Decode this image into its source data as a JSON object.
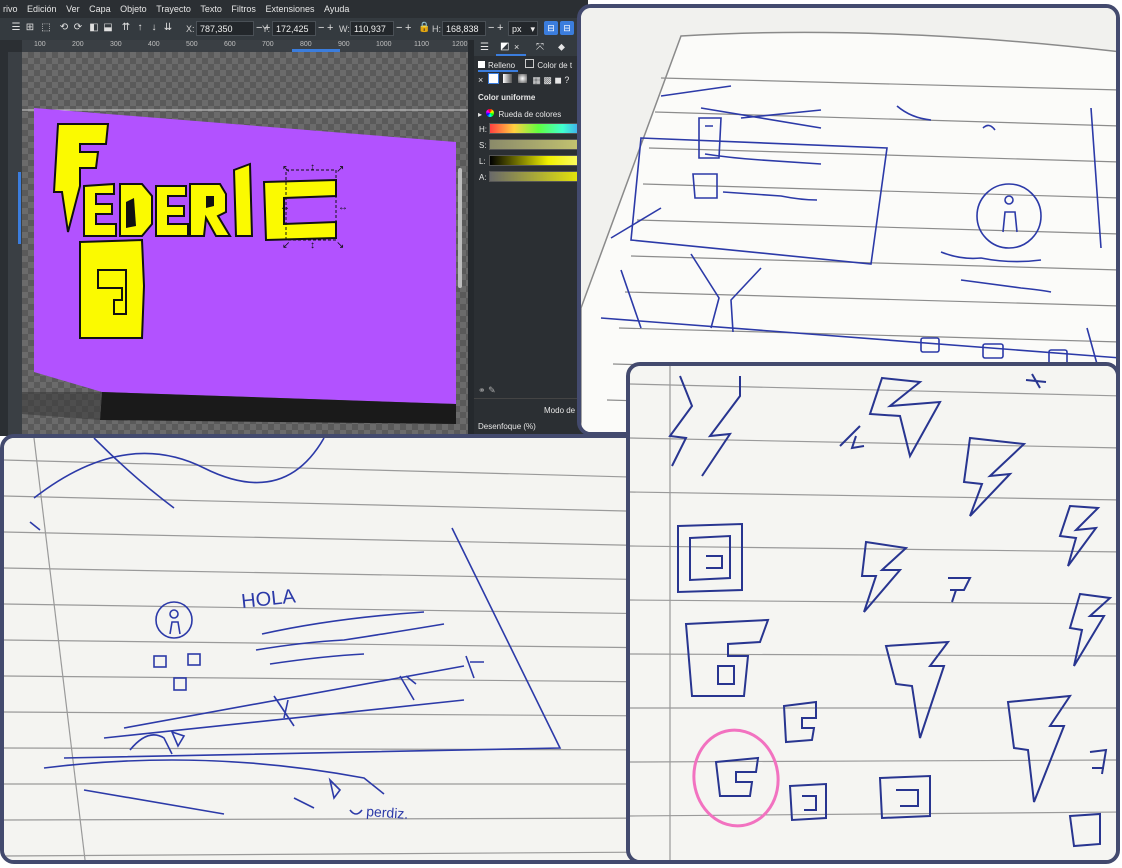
{
  "menubar": {
    "items": [
      "rivo",
      "Edición",
      "Ver",
      "Capa",
      "Objeto",
      "Trayecto",
      "Texto",
      "Filtros",
      "Extensiones",
      "Ayuda"
    ]
  },
  "toolbar": {
    "x_label": "X:",
    "x_value": "787,350",
    "y_label": "Y:",
    "y_value": "172,425",
    "w_label": "W:",
    "w_value": "110,937",
    "h_label": "H:",
    "h_value": "168,838",
    "unit": "px",
    "minus": "−",
    "plus": "+"
  },
  "ruler": {
    "ticks": [
      "100",
      "200",
      "300",
      "400",
      "500",
      "600",
      "700",
      "800",
      "900",
      "1000",
      "1100",
      "1200"
    ]
  },
  "canvas": {
    "word_top": "FEDERIC",
    "word_bottom": "G",
    "background_color": "#b252ff",
    "letter_fill": "#fbfa00"
  },
  "fill_panel": {
    "tab_fill": "Relleno",
    "tab_stroke": "Color de t",
    "flat_color_title": "Color uniforme",
    "wheel_label": "Rueda de colores",
    "h_label": "H:",
    "s_label": "S:",
    "l_label": "L:",
    "a_label": "A:",
    "blend_label": "Modo de",
    "blur_label": "Desenfoque (%)"
  },
  "sketch_left": {
    "hola_text": "HOLA",
    "perdiz_text": "perdiz."
  }
}
